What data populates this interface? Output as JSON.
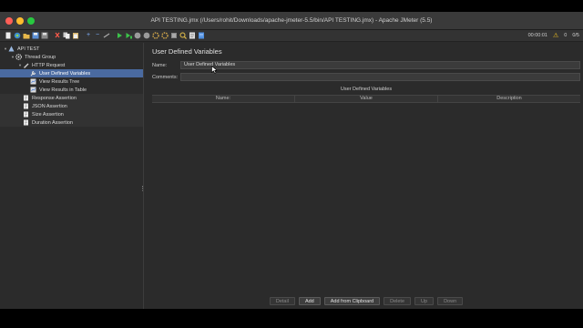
{
  "window": {
    "title": "API TESTING.jmx (/Users/rohit/Downloads/apache-jmeter-5.5/bin/API TESTING.jmx) - Apache JMeter (5.5)"
  },
  "toolbar": {
    "elapsed": "00:00:01",
    "warnings": "0",
    "threads": "0/5",
    "icons": [
      "new-icon",
      "templates-icon",
      "open-icon",
      "save-icon",
      "save-as-icon",
      "cut-icon",
      "copy-icon",
      "paste-icon",
      "expand-icon",
      "collapse-icon",
      "toggle-icon",
      "start-icon",
      "start-no-pause-icon",
      "stop-icon",
      "shutdown-icon",
      "clear-icon",
      "clear-all-icon",
      "search-icon",
      "reset-search-icon",
      "function-helper-icon",
      "help-icon"
    ]
  },
  "tree": {
    "items": [
      {
        "label": "API TEST",
        "level": 0,
        "arrow": "▾",
        "icon": "test-plan-icon"
      },
      {
        "label": "Thread Group",
        "level": 1,
        "arrow": "▾",
        "icon": "gear-icon"
      },
      {
        "label": "HTTP Request",
        "level": 2,
        "arrow": "▾",
        "icon": "pencil-icon"
      },
      {
        "label": "User Defined Variables",
        "level": 3,
        "arrow": "",
        "icon": "wrench-icon",
        "selected": true
      },
      {
        "label": "View Results Tree",
        "level": 3,
        "arrow": "",
        "icon": "chart-icon"
      },
      {
        "label": "View Results in Table",
        "level": 3,
        "arrow": "",
        "icon": "chart-icon"
      },
      {
        "label": "Response Assertion",
        "level": 2,
        "arrow": "",
        "icon": "document-icon"
      },
      {
        "label": "JSON Assertion",
        "level": 2,
        "arrow": "",
        "icon": "document-icon"
      },
      {
        "label": "Size Assertion",
        "level": 2,
        "arrow": "",
        "icon": "document-icon"
      },
      {
        "label": "Duration Assertion",
        "level": 2,
        "arrow": "",
        "icon": "document-icon"
      }
    ]
  },
  "panel": {
    "title": "User Defined Variables",
    "name_label": "Name:",
    "name_value": "User Defined Variables",
    "comments_label": "Comments:",
    "comments_value": "",
    "table_title": "User Defined Variables",
    "columns": [
      "Name:",
      "Value",
      "Description"
    ],
    "buttons": [
      {
        "label": "Detail",
        "enabled": false
      },
      {
        "label": "Add",
        "enabled": true
      },
      {
        "label": "Add from Clipboard",
        "enabled": true
      },
      {
        "label": "Delete",
        "enabled": false
      },
      {
        "label": "Up",
        "enabled": false
      },
      {
        "label": "Down",
        "enabled": false
      }
    ]
  }
}
